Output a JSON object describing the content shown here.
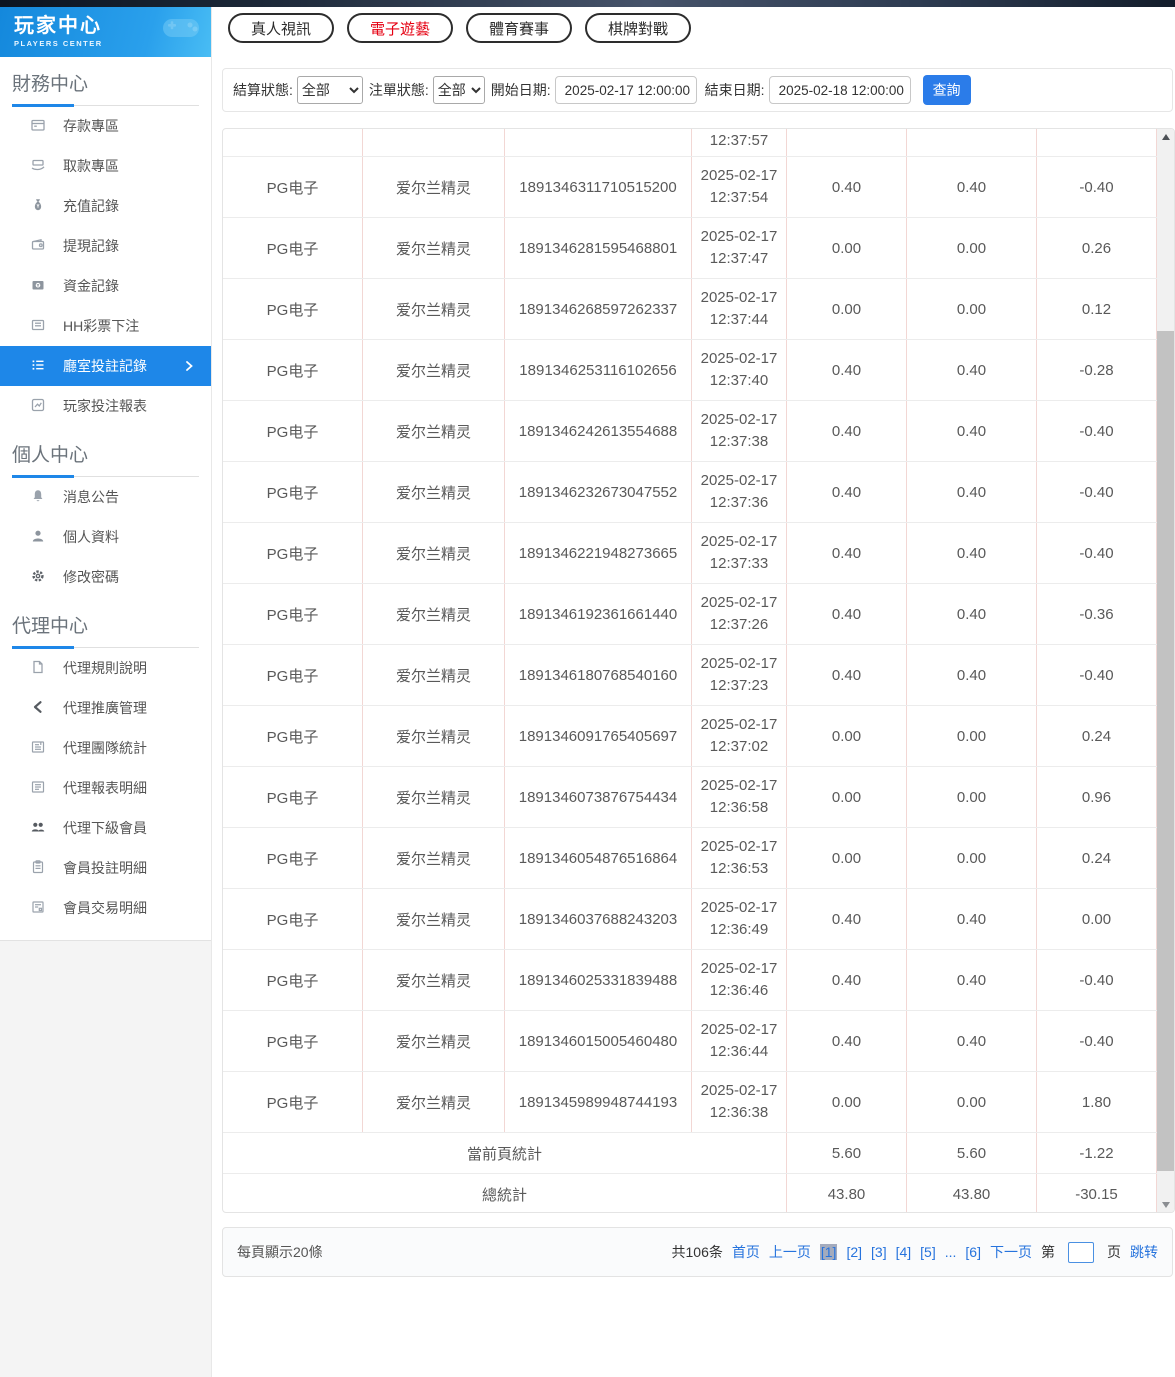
{
  "app": {
    "title": "玩家中心",
    "subtitle": "PLAYERS CENTER"
  },
  "colors": {
    "accent_blue": "#1e87e8",
    "link_blue": "#2673dd",
    "active_tab_red": "#e60012",
    "search_btn_blue": "#2b7ce9"
  },
  "sidebar": {
    "sections": [
      {
        "title": "財務中心",
        "items": [
          {
            "label": "存款專區"
          },
          {
            "label": "取款專區"
          },
          {
            "label": "充值記錄"
          },
          {
            "label": "提現記錄"
          },
          {
            "label": "資金記錄"
          },
          {
            "label": "HH彩票下注"
          },
          {
            "label": "廳室投註記錄"
          },
          {
            "label": "玩家投注報表"
          }
        ]
      },
      {
        "title": "個人中心",
        "items": [
          {
            "label": "消息公告"
          },
          {
            "label": "個人資料"
          },
          {
            "label": "修改密碼"
          }
        ]
      },
      {
        "title": "代理中心",
        "items": [
          {
            "label": "代理規則說明"
          },
          {
            "label": "代理推廣管理"
          },
          {
            "label": "代理團隊統計"
          },
          {
            "label": "代理報表明細"
          },
          {
            "label": "代理下級會員"
          },
          {
            "label": "會員投註明細"
          },
          {
            "label": "會員交易明細"
          }
        ]
      }
    ]
  },
  "tabs": [
    {
      "label": "真人視訊"
    },
    {
      "label": "電子遊藝"
    },
    {
      "label": "體育賽事"
    },
    {
      "label": "棋牌對戰"
    }
  ],
  "filters": {
    "settle_status_label": "結算狀態:",
    "settle_status_value": "全部",
    "order_status_label": "注單狀態:",
    "order_status_value": "全部",
    "start_label": "開始日期:",
    "start_value": "2025-02-17 12:00:00",
    "end_label": "結束日期:",
    "end_value": "2025-02-18 12:00:00",
    "search_label": "查詢"
  },
  "table": {
    "partial_row": {
      "time": "12:37:57"
    },
    "rows": [
      {
        "platform": "PG电子",
        "game": "爱尔兰精灵",
        "order_id": "1891346311710515200",
        "date": "2025-02-17",
        "time": "12:37:54",
        "bet": "0.40",
        "valid_bet": "0.40",
        "profit": "-0.40"
      },
      {
        "platform": "PG电子",
        "game": "爱尔兰精灵",
        "order_id": "1891346281595468801",
        "date": "2025-02-17",
        "time": "12:37:47",
        "bet": "0.00",
        "valid_bet": "0.00",
        "profit": "0.26"
      },
      {
        "platform": "PG电子",
        "game": "爱尔兰精灵",
        "order_id": "1891346268597262337",
        "date": "2025-02-17",
        "time": "12:37:44",
        "bet": "0.00",
        "valid_bet": "0.00",
        "profit": "0.12"
      },
      {
        "platform": "PG电子",
        "game": "爱尔兰精灵",
        "order_id": "1891346253116102656",
        "date": "2025-02-17",
        "time": "12:37:40",
        "bet": "0.40",
        "valid_bet": "0.40",
        "profit": "-0.28"
      },
      {
        "platform": "PG电子",
        "game": "爱尔兰精灵",
        "order_id": "1891346242613554688",
        "date": "2025-02-17",
        "time": "12:37:38",
        "bet": "0.40",
        "valid_bet": "0.40",
        "profit": "-0.40"
      },
      {
        "platform": "PG电子",
        "game": "爱尔兰精灵",
        "order_id": "1891346232673047552",
        "date": "2025-02-17",
        "time": "12:37:36",
        "bet": "0.40",
        "valid_bet": "0.40",
        "profit": "-0.40"
      },
      {
        "platform": "PG电子",
        "game": "爱尔兰精灵",
        "order_id": "1891346221948273665",
        "date": "2025-02-17",
        "time": "12:37:33",
        "bet": "0.40",
        "valid_bet": "0.40",
        "profit": "-0.40"
      },
      {
        "platform": "PG电子",
        "game": "爱尔兰精灵",
        "order_id": "1891346192361661440",
        "date": "2025-02-17",
        "time": "12:37:26",
        "bet": "0.40",
        "valid_bet": "0.40",
        "profit": "-0.36"
      },
      {
        "platform": "PG电子",
        "game": "爱尔兰精灵",
        "order_id": "1891346180768540160",
        "date": "2025-02-17",
        "time": "12:37:23",
        "bet": "0.40",
        "valid_bet": "0.40",
        "profit": "-0.40"
      },
      {
        "platform": "PG电子",
        "game": "爱尔兰精灵",
        "order_id": "1891346091765405697",
        "date": "2025-02-17",
        "time": "12:37:02",
        "bet": "0.00",
        "valid_bet": "0.00",
        "profit": "0.24"
      },
      {
        "platform": "PG电子",
        "game": "爱尔兰精灵",
        "order_id": "1891346073876754434",
        "date": "2025-02-17",
        "time": "12:36:58",
        "bet": "0.00",
        "valid_bet": "0.00",
        "profit": "0.96"
      },
      {
        "platform": "PG电子",
        "game": "爱尔兰精灵",
        "order_id": "1891346054876516864",
        "date": "2025-02-17",
        "time": "12:36:53",
        "bet": "0.00",
        "valid_bet": "0.00",
        "profit": "0.24"
      },
      {
        "platform": "PG电子",
        "game": "爱尔兰精灵",
        "order_id": "1891346037688243203",
        "date": "2025-02-17",
        "time": "12:36:49",
        "bet": "0.40",
        "valid_bet": "0.40",
        "profit": "0.00"
      },
      {
        "platform": "PG电子",
        "game": "爱尔兰精灵",
        "order_id": "1891346025331839488",
        "date": "2025-02-17",
        "time": "12:36:46",
        "bet": "0.40",
        "valid_bet": "0.40",
        "profit": "-0.40"
      },
      {
        "platform": "PG电子",
        "game": "爱尔兰精灵",
        "order_id": "1891346015005460480",
        "date": "2025-02-17",
        "time": "12:36:44",
        "bet": "0.40",
        "valid_bet": "0.40",
        "profit": "-0.40"
      },
      {
        "platform": "PG电子",
        "game": "爱尔兰精灵",
        "order_id": "1891345989948744193",
        "date": "2025-02-17",
        "time": "12:36:38",
        "bet": "0.00",
        "valid_bet": "0.00",
        "profit": "1.80"
      }
    ],
    "page_summary": {
      "label": "當前頁統計",
      "bet": "5.60",
      "valid_bet": "5.60",
      "profit": "-1.22"
    },
    "total_summary": {
      "label": "總統計",
      "bet": "43.80",
      "valid_bet": "43.80",
      "profit": "-30.15"
    }
  },
  "pagination": {
    "per_page": "每頁顯示20條",
    "total": "共106条",
    "first": "首页",
    "prev": "上一页",
    "pages": [
      "[1]",
      "[2]",
      "[3]",
      "[4]",
      "[5]",
      "...",
      "[6]"
    ],
    "next": "下一页",
    "jump_prefix": "第",
    "jump_suffix": "页",
    "jump_button": "跳转"
  }
}
